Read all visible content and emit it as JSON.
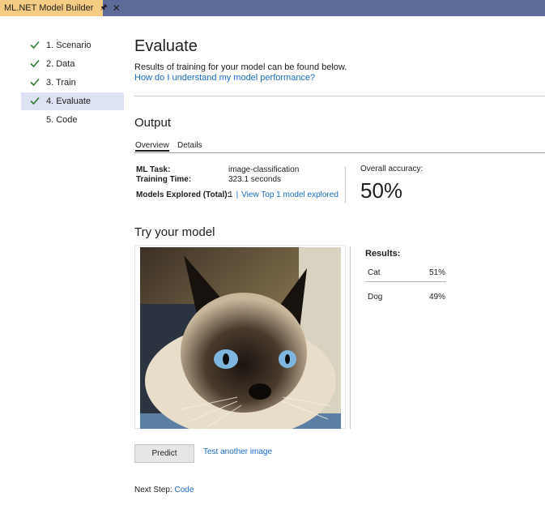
{
  "window": {
    "tab_title": "ML.NET Model Builder",
    "pin_icon": "pin-icon",
    "close_icon": "close-icon"
  },
  "sidebar": {
    "items": [
      {
        "label": "1. Scenario",
        "completed": true,
        "selected": false
      },
      {
        "label": "2. Data",
        "completed": true,
        "selected": false
      },
      {
        "label": "3. Train",
        "completed": true,
        "selected": false
      },
      {
        "label": "4. Evaluate",
        "completed": true,
        "selected": true
      },
      {
        "label": "5. Code",
        "completed": false,
        "selected": false
      }
    ]
  },
  "main": {
    "title": "Evaluate",
    "description": "Results of training for your model can be found below.",
    "help_link": "How do I understand my model performance?",
    "output": {
      "heading": "Output",
      "tabs": [
        "Overview",
        "Details"
      ],
      "active_tab": "Overview",
      "ml_task_label": "ML Task:",
      "ml_task_value": "image-classification",
      "training_time_label": "Training Time:",
      "training_time_value": "323.1 seconds",
      "models_explored_label": "Models Explored (Total):",
      "models_explored_value": "1",
      "models_separator": "|",
      "view_models_link": "View Top 1 model explored",
      "accuracy_label": "Overall accuracy:",
      "accuracy_value": "50%"
    },
    "try_model": {
      "heading": "Try your model",
      "results_title": "Results:",
      "results": [
        {
          "label": "Cat",
          "value": "51%"
        },
        {
          "label": "Dog",
          "value": "49%"
        }
      ],
      "predict_button": "Predict",
      "test_another_link": "Test another image"
    },
    "next_step": {
      "label": "Next Step:",
      "link": "Code"
    }
  },
  "colors": {
    "titlebar": "#5d6b99",
    "active_tab": "#f5cc84",
    "check": "#2e7d32",
    "selected_nav": "#dde3f5",
    "link": "#1a6bc4"
  }
}
